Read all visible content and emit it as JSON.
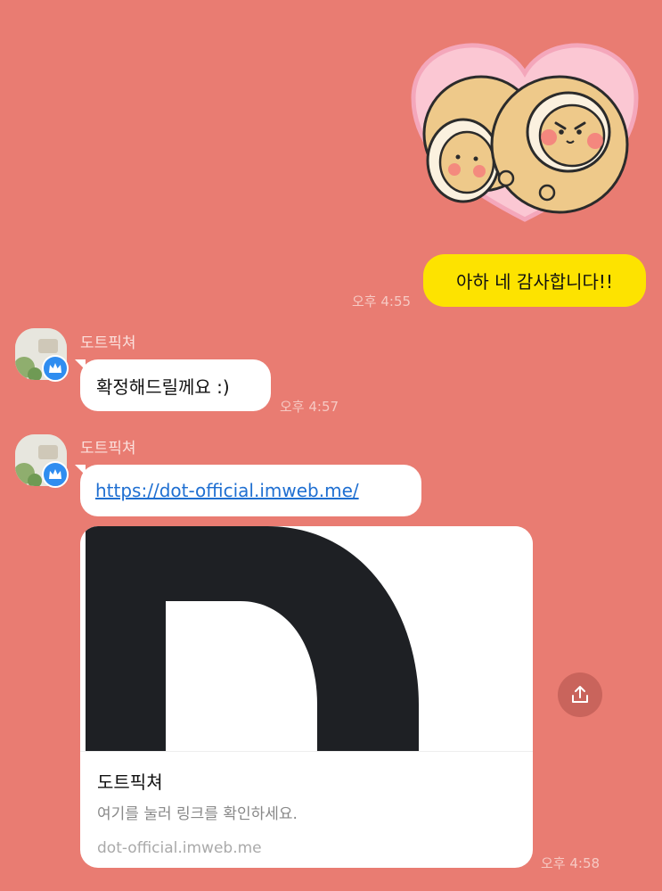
{
  "messages": {
    "outgoing_text": "아하 네 감사합니다!!",
    "outgoing_time": "오후 4:55",
    "msg1": {
      "sender": "도트픽쳐",
      "text": "확정해드릴께요 :)",
      "time": "오후 4:57"
    },
    "msg2": {
      "sender": "도트픽쳐",
      "link": "https://dot-official.imweb.me/",
      "time": "오후 4:58"
    }
  },
  "link_preview": {
    "logo_letter": "D",
    "title": "도트픽쳐",
    "description": "여기를 눌러 링크를 확인하세요.",
    "domain": "dot-official.imweb.me"
  },
  "icons": {
    "sticker": "heart-sticker-icon",
    "crown": "crown-icon",
    "share": "share-icon"
  },
  "colors": {
    "chat_background": "#e97c72",
    "outgoing_bubble": "#fde300",
    "incoming_bubble": "#ffffff",
    "link_text": "#1f6fd1",
    "badge": "#2f8df0"
  }
}
